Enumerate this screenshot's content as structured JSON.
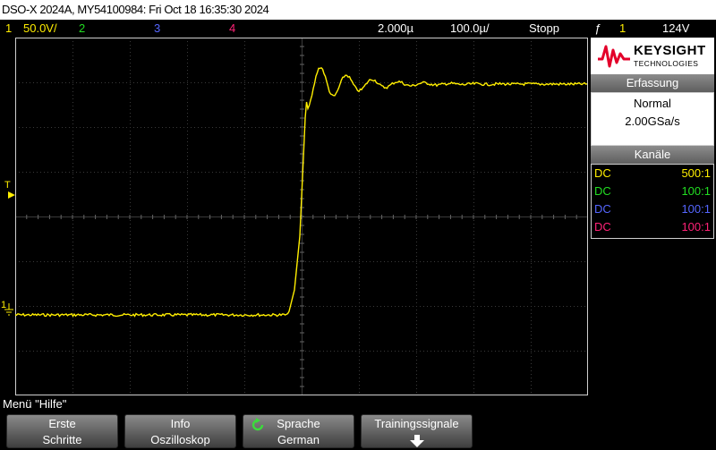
{
  "title": "DSO-X 2024A, MY54100984: Fri Oct 18 16:35:30 2024",
  "status": {
    "ch1_num": "1",
    "ch1_scale": "50.0V/",
    "ch2_num": "2",
    "ch3_num": "3",
    "ch4_num": "4",
    "timebase": "2.000µ",
    "delay": "100.0µ/",
    "run_state": "Stopp",
    "trigger_icon": "ƒ",
    "trigger_source": "1",
    "trigger_level": "124V"
  },
  "colors": {
    "ch1": "#ffee00",
    "ch2": "#22dd22",
    "ch3": "#5566ff",
    "ch4": "#ff2277",
    "logo_red": "#e3002a"
  },
  "markers": {
    "trigger_level": "T",
    "ground_ch1": "1"
  },
  "logo": {
    "name": "KEYSIGHT",
    "sub": "TECHNOLOGIES"
  },
  "acquisition": {
    "header": "Erfassung",
    "mode": "Normal",
    "rate": "2.00GSa/s"
  },
  "channels": {
    "header": "Kanäle",
    "rows": [
      {
        "coupling": "DC",
        "probe": "500:1"
      },
      {
        "coupling": "DC",
        "probe": "100:1"
      },
      {
        "coupling": "DC",
        "probe": "100:1"
      },
      {
        "coupling": "DC",
        "probe": "100:1"
      }
    ]
  },
  "menu": {
    "label": "Menü \"Hilfe\"",
    "softkeys": [
      {
        "line1": "Erste",
        "line2": "Schritte"
      },
      {
        "line1": "Info",
        "line2": "Oszilloskop"
      },
      {
        "line1": "Sprache",
        "line2": "German"
      },
      {
        "line1": "Trainingssignale",
        "line2": ""
      }
    ]
  }
}
